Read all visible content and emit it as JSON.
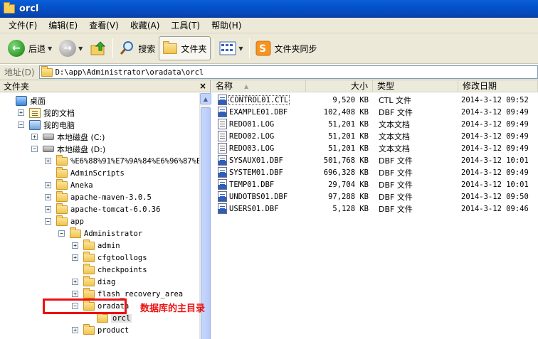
{
  "window": {
    "title": "orcl"
  },
  "menu": [
    "文件(F)",
    "编辑(E)",
    "查看(V)",
    "收藏(A)",
    "工具(T)",
    "帮助(H)"
  ],
  "toolbar": {
    "back_label": "后退",
    "search_label": "搜索",
    "folders_label": "文件夹",
    "sync_label": "文件夹同步"
  },
  "address": {
    "label": "地址(D)",
    "value": "D:\\app\\Administrator\\oradata\\orcl"
  },
  "folders_panel": {
    "title": "文件夹",
    "tree": [
      {
        "label": "桌面",
        "level": 0,
        "expander": "minus",
        "icon": "desktop-icon"
      },
      {
        "label": "我的文档",
        "level": 1,
        "expander": "plus",
        "icon": "documents-icon"
      },
      {
        "label": "我的电脑",
        "level": 1,
        "expander": "minus",
        "icon": "computer-icon"
      },
      {
        "label": "本地磁盘 (C:)",
        "level": 2,
        "expander": "plus",
        "icon": "disk-icon"
      },
      {
        "label": "本地磁盘 (D:)",
        "level": 2,
        "expander": "minus",
        "icon": "disk-icon"
      },
      {
        "label": "%E6%88%91%E7%9A%84%E6%96%87%E6%A1",
        "level": 3,
        "expander": "plus",
        "icon": "folder-icon"
      },
      {
        "label": "AdminScripts",
        "level": 3,
        "expander": "none",
        "icon": "folder-icon"
      },
      {
        "label": "Aneka",
        "level": 3,
        "expander": "plus",
        "icon": "folder-icon"
      },
      {
        "label": "apache-maven-3.0.5",
        "level": 3,
        "expander": "plus",
        "icon": "folder-icon"
      },
      {
        "label": "apache-tomcat-6.0.36",
        "level": 3,
        "expander": "plus",
        "icon": "folder-icon"
      },
      {
        "label": "app",
        "level": 3,
        "expander": "minus",
        "icon": "folder-icon"
      },
      {
        "label": "Administrator",
        "level": 4,
        "expander": "minus",
        "icon": "folder-icon"
      },
      {
        "label": "admin",
        "level": 5,
        "expander": "plus",
        "icon": "folder-icon"
      },
      {
        "label": "cfgtoollogs",
        "level": 5,
        "expander": "plus",
        "icon": "folder-icon"
      },
      {
        "label": "checkpoints",
        "level": 5,
        "expander": "none",
        "icon": "folder-icon"
      },
      {
        "label": "diag",
        "level": 5,
        "expander": "plus",
        "icon": "folder-icon"
      },
      {
        "label": "flash_recovery_area",
        "level": 5,
        "expander": "plus",
        "icon": "folder-icon"
      },
      {
        "label": "oradata",
        "level": 5,
        "expander": "minus",
        "icon": "folder-icon"
      },
      {
        "label": "orcl",
        "level": 6,
        "expander": "none",
        "icon": "folder-icon",
        "selected": true
      },
      {
        "label": "product",
        "level": 5,
        "expander": "plus",
        "icon": "folder-icon"
      }
    ]
  },
  "file_list": {
    "columns": {
      "name": "名称",
      "size": "大小",
      "type": "类型",
      "modified": "修改日期"
    },
    "rows": [
      {
        "name": "CONTROL01.CTL",
        "size": "9,520 KB",
        "type": "CTL 文件",
        "modified": "2014-3-12 09:52",
        "icon": "ctl-file-icon"
      },
      {
        "name": "EXAMPLE01.DBF",
        "size": "102,408 KB",
        "type": "DBF 文件",
        "modified": "2014-3-12 09:49",
        "icon": "dbf-file-icon"
      },
      {
        "name": "REDO01.LOG",
        "size": "51,201 KB",
        "type": "文本文档",
        "modified": "2014-3-12 09:49",
        "icon": "text-file-icon"
      },
      {
        "name": "REDO02.LOG",
        "size": "51,201 KB",
        "type": "文本文档",
        "modified": "2014-3-12 09:49",
        "icon": "text-file-icon"
      },
      {
        "name": "REDO03.LOG",
        "size": "51,201 KB",
        "type": "文本文档",
        "modified": "2014-3-12 09:49",
        "icon": "text-file-icon"
      },
      {
        "name": "SYSAUX01.DBF",
        "size": "501,768 KB",
        "type": "DBF 文件",
        "modified": "2014-3-12 10:01",
        "icon": "dbf-file-icon"
      },
      {
        "name": "SYSTEM01.DBF",
        "size": "696,328 KB",
        "type": "DBF 文件",
        "modified": "2014-3-12 09:49",
        "icon": "dbf-file-icon"
      },
      {
        "name": "TEMP01.DBF",
        "size": "29,704 KB",
        "type": "DBF 文件",
        "modified": "2014-3-12 10:01",
        "icon": "dbf-file-icon"
      },
      {
        "name": "UNDOTBS01.DBF",
        "size": "97,288 KB",
        "type": "DBF 文件",
        "modified": "2014-3-12 09:50",
        "icon": "dbf-file-icon"
      },
      {
        "name": "USERS01.DBF",
        "size": "5,128 KB",
        "type": "DBF 文件",
        "modified": "2014-3-12 09:46",
        "icon": "dbf-file-icon"
      }
    ]
  },
  "annotation": {
    "text": "数据库的主目录",
    "color": "#ee1111"
  },
  "colors": {
    "titlebar": "#0451c9",
    "chrome": "#ece9d8",
    "annotation": "#ee1111"
  }
}
